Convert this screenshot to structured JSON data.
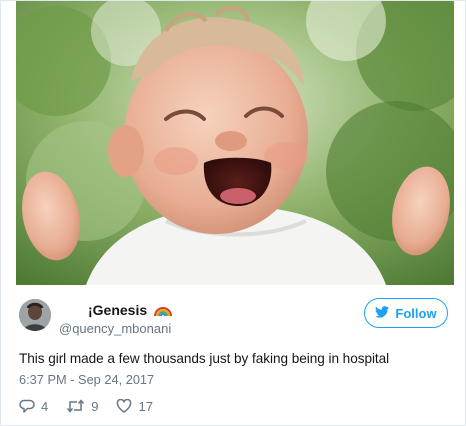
{
  "tweet": {
    "author_name": "¡Genesis",
    "author_emoji": "rainbow-icon",
    "author_handle": "@quency_mbonani",
    "text": "This girl made a few thousands just by faking being in hospital",
    "timestamp": "6:37 PM - Sep 24, 2017",
    "follow_label": "Follow",
    "replies": "4",
    "retweets": "9",
    "likes": "17"
  },
  "media": {
    "icon": "info-icon"
  },
  "colors": {
    "accent": "#1da1f2",
    "text": "#14171a",
    "muted": "#657786",
    "border": "#e1e8ed"
  }
}
